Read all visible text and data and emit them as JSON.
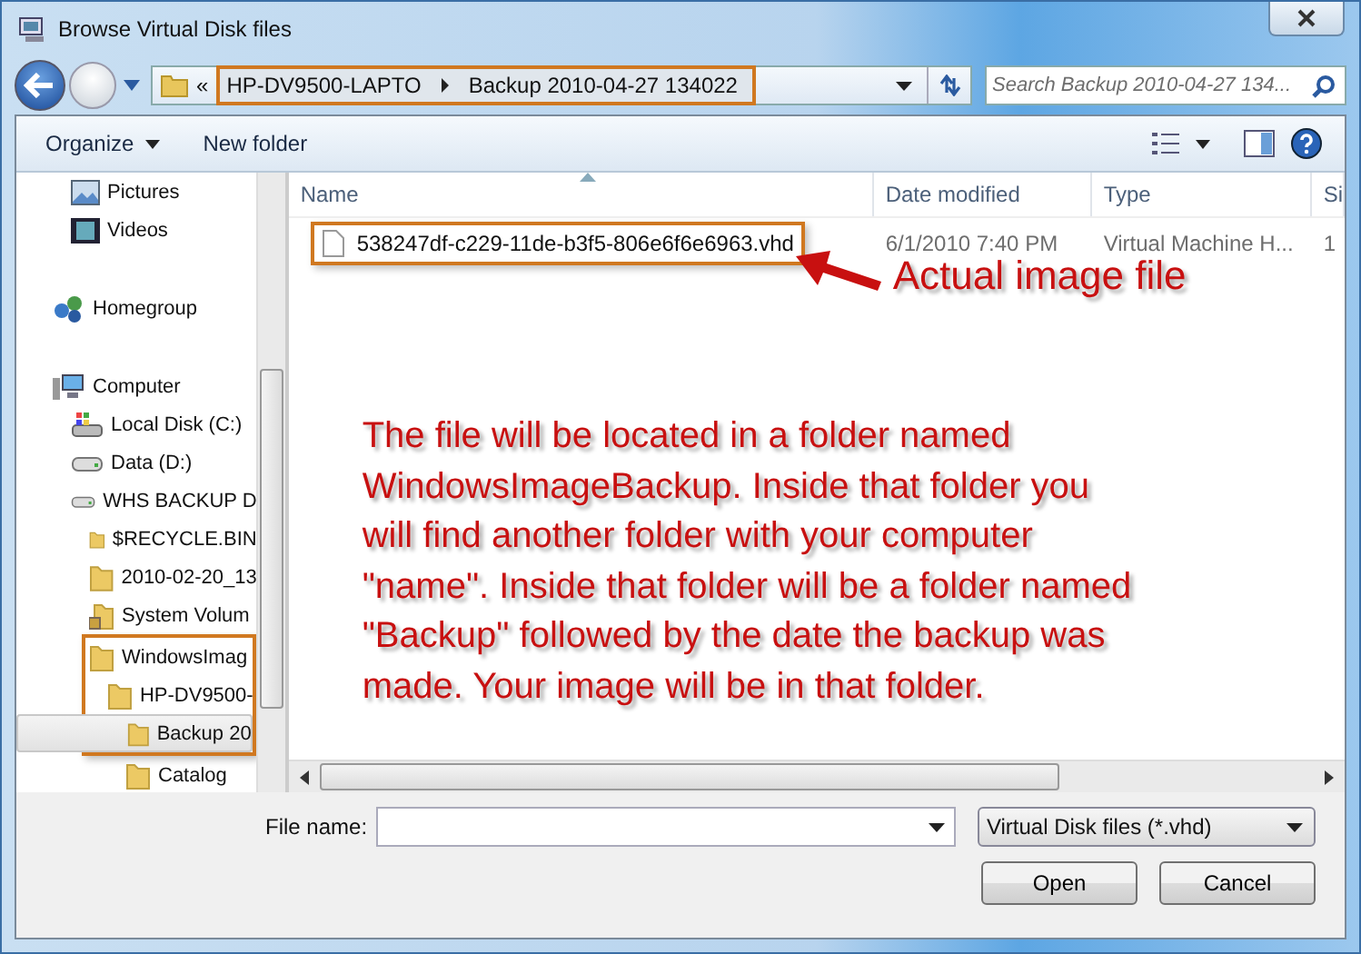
{
  "window": {
    "title": "Browse Virtual Disk files"
  },
  "address": {
    "overflow": "«",
    "crumbs": [
      "HP-DV9500-LAPTO",
      "Backup 2010-04-27 134022"
    ],
    "highlighted": true
  },
  "search": {
    "placeholder": "Search Backup 2010-04-27 134..."
  },
  "toolbar": {
    "organize": "Organize",
    "new_folder": "New folder"
  },
  "nav": {
    "sections": [
      {
        "kind": "continued",
        "items": [
          {
            "label": "Pictures",
            "kind": "pictures",
            "selected": false,
            "highlighted": false
          },
          {
            "label": "Videos",
            "kind": "videos",
            "selected": false,
            "highlighted": false
          }
        ]
      },
      {
        "kind": "root",
        "items": [
          {
            "label": "Homegroup",
            "kind": "homegroup",
            "selected": false,
            "highlighted": false
          }
        ]
      },
      {
        "kind": "root",
        "items": [
          {
            "label": "Computer",
            "kind": "computer",
            "selected": false,
            "highlighted": false,
            "children": [
              {
                "label": "Local Disk (C:)",
                "kind": "os-drive",
                "selected": false,
                "highlighted": false
              },
              {
                "label": "Data (D:)",
                "kind": "drive",
                "selected": false,
                "highlighted": false
              },
              {
                "label": "WHS BACKUP D",
                "kind": "drive",
                "selected": false,
                "highlighted": false,
                "children": [
                  {
                    "label": "$RECYCLE.BIN",
                    "kind": "folder",
                    "selected": false,
                    "highlighted": false
                  },
                  {
                    "label": "2010-02-20_13",
                    "kind": "folder",
                    "selected": false,
                    "highlighted": false
                  },
                  {
                    "label": "System Volum",
                    "kind": "locked-folder",
                    "selected": false,
                    "highlighted": false
                  },
                  {
                    "label": "WindowsImag",
                    "kind": "folder",
                    "selected": false,
                    "highlighted": true,
                    "children": [
                      {
                        "label": "HP-DV9500-",
                        "kind": "folder",
                        "selected": false,
                        "highlighted": true,
                        "children": [
                          {
                            "label": "Backup 20",
                            "kind": "folder",
                            "selected": true,
                            "highlighted": true
                          },
                          {
                            "label": "Catalog",
                            "kind": "folder",
                            "selected": false,
                            "highlighted": false
                          }
                        ]
                      }
                    ]
                  }
                ]
              }
            ]
          }
        ]
      }
    ]
  },
  "table": {
    "columns": [
      "Name",
      "Date modified",
      "Type",
      "Si"
    ],
    "rows": [
      {
        "name": "538247df-c229-11de-b3f5-806e6f6e6963.vhd",
        "date": "6/1/2010 7:40 PM",
        "type": "Virtual Machine H...",
        "column_4": "1",
        "highlighted": true
      }
    ]
  },
  "annotation": {
    "caption": "Actual image file",
    "note": "The file will be located in a folder named\nWindowsImageBackup. Inside that folder you\nwill find another folder with your computer\n\"name\". Inside that folder will be a folder named\n\"Backup\" followed by the date the backup was\nmade. Your image will be in that folder."
  },
  "footer": {
    "file_name_label": "File name:",
    "filter": "Virtual Disk files (*.vhd)",
    "buttons": [
      "Open",
      "Cancel"
    ]
  }
}
